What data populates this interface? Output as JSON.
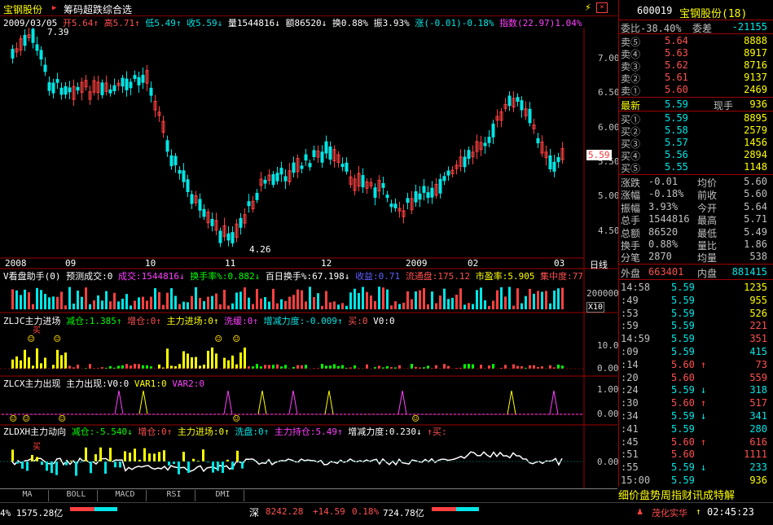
{
  "header": {
    "stock_name": "宝钢股份",
    "indicator": "筹码超跌综合选"
  },
  "info": {
    "date": "2009/03/05",
    "open": "开5.64↑",
    "high": "高5.71↑",
    "low": "低5.49↑",
    "close": "收5.59↓",
    "volume": "量1544816↓",
    "amount": "额86520↓",
    "turnover": "换0.88%",
    "amplitude": "振3.93%",
    "change": "涨(-0.01)-0.18%",
    "index": "指数(22.97)1.04%"
  },
  "main_chart": {
    "y_labels": [
      "7.00",
      "6.50",
      "6.00",
      "5.50",
      "5.00",
      "4.50"
    ],
    "max_label": "7.39",
    "min_label": "4.26",
    "price_tag": "5.59",
    "x_labels": [
      "2008",
      "09",
      "10",
      "11",
      "12",
      "2009",
      "02",
      "03"
    ],
    "period": "日线"
  },
  "vol_panel": {
    "title": "V看盘助手(0) 预测成交:0",
    "chengjiao": "成交:1544816↓",
    "huanshou": "换手率%:0.882↓",
    "bairi": "百日换手%:67.198↓",
    "shouyi": "收益:0.71",
    "liutong": "流通盘:175.12",
    "shiying": "市盈率:5.905",
    "jizhong": "集中度:77",
    "y_label": "200000",
    "unit": "X10"
  },
  "zljc_panel": {
    "title": "ZLJC主力进场",
    "jiancang": "减仓:1.385↑",
    "zengcang": "增仓:0↑",
    "zhuli": "主力进场:0↑",
    "xihuan": "洗缓:0↑",
    "zengjian": "增减力度:-0.009↑",
    "buy": "买:0",
    "v0": "V0:0",
    "y_labels": [
      "10.00",
      "0.00"
    ],
    "buy_mark": "买"
  },
  "zlcx_panel": {
    "title": "ZLCX主力出现",
    "zhuli": "主力出现:V0:0",
    "var1": "VAR1:0",
    "var2": "VAR2:0",
    "y_labels": [
      "1.00",
      "0.00"
    ]
  },
  "zldxh_panel": {
    "title": "ZLDXH主力动向",
    "jiancang": "减仓:-5.540↓",
    "zengcang": "增仓:0↑",
    "zhuli": "主力进场:0↑",
    "xipan": "洗盘:0↑",
    "chicang": "主力持仓:5.49↑",
    "zengjian": "增减力度:0.230↓",
    "buy": "↑买:",
    "y_label": "0.00",
    "buy_mark": "买"
  },
  "tabs": [
    "MA",
    "BOLL",
    "MACD",
    "RSI",
    "DMI"
  ],
  "quote": {
    "code": "600019",
    "name": "宝钢股份(18)",
    "weibi": "委比-38.40%",
    "weicha_label": "委差",
    "weicha": "-21155",
    "asks": [
      {
        "l": "卖⑤",
        "p": "5.64",
        "v": "8888"
      },
      {
        "l": "卖④",
        "p": "5.63",
        "v": "8917"
      },
      {
        "l": "卖③",
        "p": "5.62",
        "v": "8716"
      },
      {
        "l": "卖②",
        "p": "5.61",
        "v": "9137"
      },
      {
        "l": "卖①",
        "p": "5.60",
        "v": "2469"
      }
    ],
    "last": {
      "l": "最新",
      "p": "5.59",
      "l2": "现手",
      "v": "936"
    },
    "bids": [
      {
        "l": "买①",
        "p": "5.59",
        "v": "8895"
      },
      {
        "l": "买②",
        "p": "5.58",
        "v": "2579"
      },
      {
        "l": "买③",
        "p": "5.57",
        "v": "1456"
      },
      {
        "l": "买④",
        "p": "5.56",
        "v": "2894"
      },
      {
        "l": "买⑤",
        "p": "5.55",
        "v": "1148"
      }
    ],
    "stats": [
      {
        "a": "涨跌",
        "b": "-0.01",
        "c": "均价",
        "d": "5.60"
      },
      {
        "a": "涨幅",
        "b": "-0.18%",
        "c": "前收",
        "d": "5.60"
      },
      {
        "a": "振幅",
        "b": "3.93%",
        "c": "今开",
        "d": "5.64"
      },
      {
        "a": "总手",
        "b": "1544816",
        "c": "最高",
        "d": "5.71"
      },
      {
        "a": "总额",
        "b": "86520",
        "c": "最低",
        "d": "5.49"
      },
      {
        "a": "换手",
        "b": "0.88%",
        "c": "量比",
        "d": "1.86"
      },
      {
        "a": "分笔",
        "b": "2870",
        "c": "均量",
        "d": "538"
      }
    ],
    "waipan_label": "外盘",
    "waipan": "663401",
    "neipan_label": "内盘",
    "neipan": "881415",
    "ticks": [
      {
        "t": "14:58",
        "p": "5.59",
        "a": "",
        "v": "1235",
        "c": "#ffff00"
      },
      {
        "t": ":49",
        "p": "5.59",
        "a": "",
        "v": "955",
        "c": "#ffff00"
      },
      {
        "t": ":53",
        "p": "5.59",
        "a": "",
        "v": "526",
        "c": "#ffff00"
      },
      {
        "t": ":59",
        "p": "5.59",
        "a": "",
        "v": "221",
        "c": "#ff5050"
      },
      {
        "t": "14:59",
        "p": "5.59",
        "a": "",
        "v": "351",
        "c": "#ff5050"
      },
      {
        "t": ":09",
        "p": "5.59",
        "a": "",
        "v": "415",
        "c": "#00e6e6"
      },
      {
        "t": ":14",
        "p": "5.60",
        "a": "↑",
        "v": "73",
        "c": "#ff5050"
      },
      {
        "t": ":20",
        "p": "5.60",
        "a": "",
        "v": "559",
        "c": "#ff5050"
      },
      {
        "t": ":24",
        "p": "5.59",
        "a": "↓",
        "v": "318",
        "c": "#00e6e6"
      },
      {
        "t": ":30",
        "p": "5.60",
        "a": "↑",
        "v": "517",
        "c": "#ff5050"
      },
      {
        "t": ":34",
        "p": "5.59",
        "a": "↓",
        "v": "341",
        "c": "#00e6e6"
      },
      {
        "t": ":41",
        "p": "5.59",
        "a": "",
        "v": "280",
        "c": "#00e6e6"
      },
      {
        "t": ":45",
        "p": "5.60",
        "a": "↑",
        "v": "616",
        "c": "#ff5050"
      },
      {
        "t": ":51",
        "p": "5.60",
        "a": "",
        "v": "1111",
        "c": "#ff5050"
      },
      {
        "t": ":55",
        "p": "5.59",
        "a": "↓",
        "v": "233",
        "c": "#00e6e6"
      },
      {
        "t": "15:00",
        "p": "5.59",
        "a": "",
        "v": "936",
        "c": "#ffff00"
      }
    ],
    "menu": "细价盘势周指财讯成特解"
  },
  "status": {
    "left": "4% 1575.28亿",
    "sz_label": "深",
    "sz_index": "8242.28",
    "sz_change": "+14.59",
    "sz_pct": "0.18%",
    "sz_amount": "724.78亿",
    "user": "茂化实华",
    "time": "02:45:23"
  },
  "colors": {
    "up": "#ff4040",
    "down": "#00e6e6",
    "accent_yellow": "#ffff00",
    "frame": "#a00000"
  }
}
